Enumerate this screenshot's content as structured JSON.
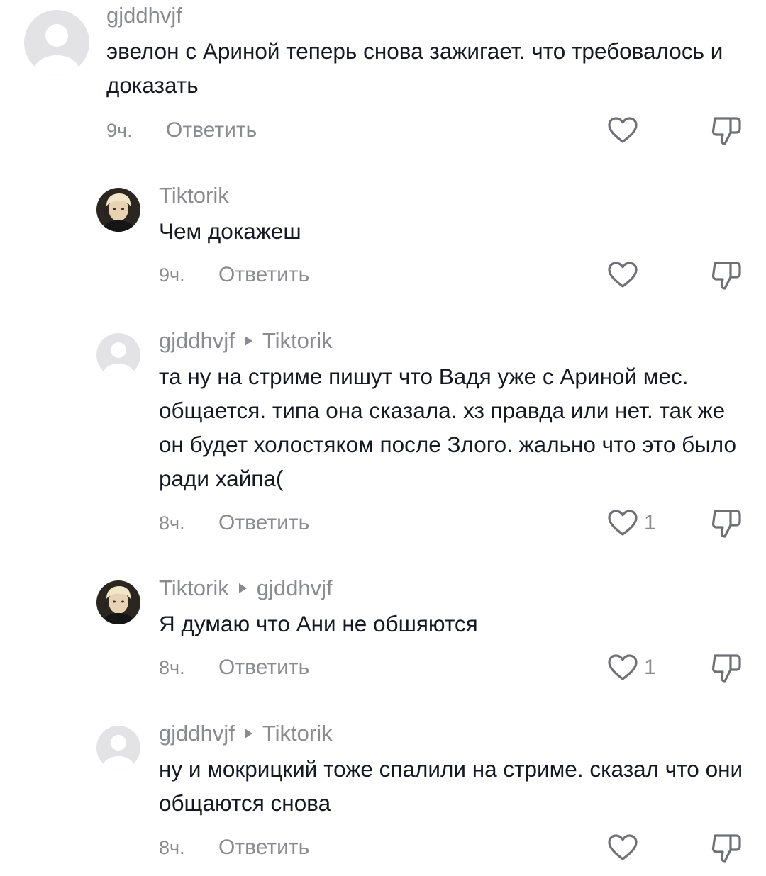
{
  "comments": [
    {
      "username": "gjddhvjf",
      "reply_to": "",
      "text": "эвелон с Ариной теперь снова зажигает. что требовалось и доказать",
      "time": "9ч.",
      "reply_label": "Ответить",
      "likes": "",
      "avatar": "default-avatar"
    },
    {
      "username": "Tiktorik",
      "reply_to": "",
      "text": "Чем докажеш",
      "time": "9ч.",
      "reply_label": "Ответить",
      "likes": "",
      "avatar": "photo-avatar"
    },
    {
      "username": "gjddhvjf",
      "reply_to": "Tiktorik",
      "text": "та ну на стриме пишут что Вадя уже с Ариной мес. общается. типа она сказала. хз правда или нет. так же он будет холостяком после Злого. жально что это было ради хайпа(",
      "time": "8ч.",
      "reply_label": "Ответить",
      "likes": "1",
      "avatar": "default-avatar"
    },
    {
      "username": "Tiktorik",
      "reply_to": "gjddhvjf",
      "text": "Я думаю что Ани не обшяются",
      "time": "8ч.",
      "reply_label": "Ответить",
      "likes": "1",
      "avatar": "photo-avatar"
    },
    {
      "username": "gjddhvjf",
      "reply_to": "Tiktorik",
      "text": "ну и мокрицкий тоже спалили на стриме. сказал что они общаются снова",
      "time": "8ч.",
      "reply_label": "Ответить",
      "likes": "",
      "avatar": "default-avatar"
    }
  ],
  "colors": {
    "text": "#161823",
    "muted": "#8a8b91",
    "icon": "#6f7075",
    "avatar_bg": "#e3e3e6"
  },
  "icons": [
    "heart-icon",
    "dislike-icon",
    "reply-arrow-icon"
  ]
}
